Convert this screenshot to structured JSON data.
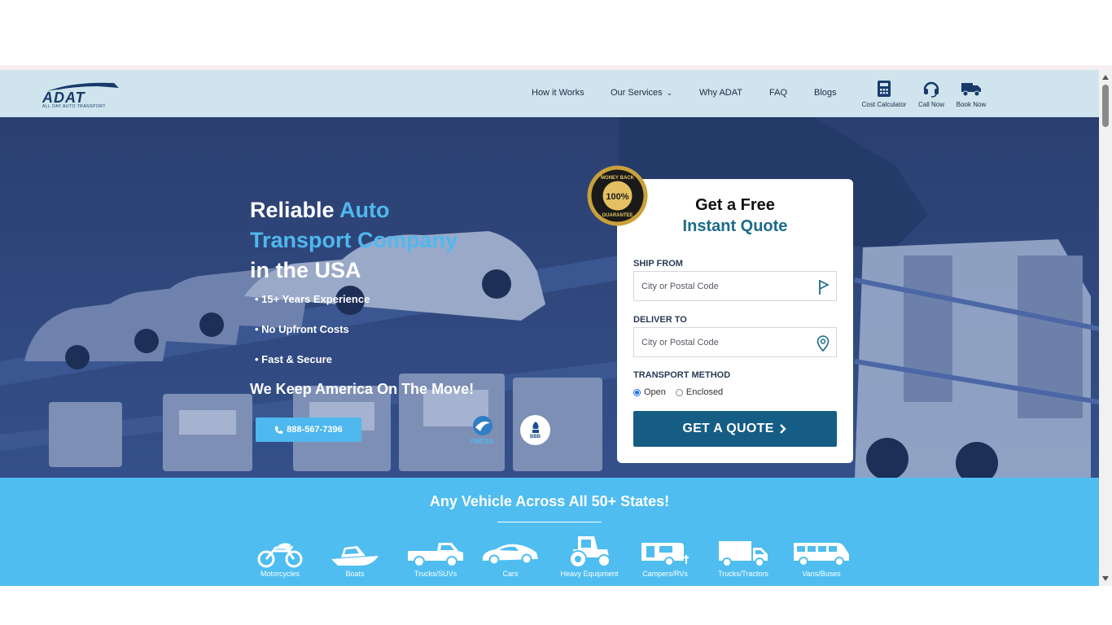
{
  "brand": {
    "logo_text": "ADAT",
    "logo_subtext": "ALL DAY AUTO TRANSPORT"
  },
  "nav": {
    "items": [
      {
        "label": "How it Works"
      },
      {
        "label": "Our Services"
      },
      {
        "label": "Why ADAT"
      },
      {
        "label": "FAQ"
      },
      {
        "label": "Blogs"
      }
    ],
    "actions": [
      {
        "label": "Cost Calculator",
        "icon": "calculator-icon"
      },
      {
        "label": "Call Now",
        "icon": "headset-icon"
      },
      {
        "label": "Book Now",
        "icon": "truck-icon"
      }
    ]
  },
  "hero": {
    "title_part1": "Reliable ",
    "title_accent": "Auto Transport Company",
    "title_part2": "in the USA",
    "bullets": [
      "• 15+ Years Experience",
      "• No Upfront Costs",
      "• Fast & Secure"
    ],
    "tagline": "We Keep America On The Move!",
    "phone": "888-567-7396",
    "fmcsa_label": "FMCSA",
    "bbb_label": "BBB",
    "badge": {
      "top_text": "MONEY BACK",
      "center_text": "100%",
      "bottom_text": "GUARANTEE"
    }
  },
  "quote": {
    "title_line1": "Get a Free",
    "title_line2": "Instant Quote",
    "ship_from_label": "SHIP FROM",
    "ship_from_placeholder": "City or Postal Code",
    "deliver_to_label": "DELIVER TO",
    "deliver_to_placeholder": "City or Postal Code",
    "transport_label": "TRANSPORT METHOD",
    "options": [
      {
        "label": "Open",
        "selected": true
      },
      {
        "label": "Enclosed",
        "selected": false
      }
    ],
    "button_label": "GET A QUOTE"
  },
  "vehicles": {
    "title": "Any Vehicle Across All 50+ States!",
    "items": [
      {
        "label": "Motorcycles",
        "icon": "motorcycle-icon"
      },
      {
        "label": "Boats",
        "icon": "boat-icon"
      },
      {
        "label": "Trucks/SUVs",
        "icon": "pickup-truck-icon"
      },
      {
        "label": "Cars",
        "icon": "car-icon"
      },
      {
        "label": "Heavy Equipment",
        "icon": "tractor-icon"
      },
      {
        "label": "Campers/RVs",
        "icon": "camper-icon"
      },
      {
        "label": "Trucks/Tractors",
        "icon": "box-truck-icon"
      },
      {
        "label": "Vans/Buses",
        "icon": "van-icon"
      }
    ]
  },
  "colors": {
    "header_bg": "#cfe4ec",
    "hero_overlay": "#2a3f70",
    "accent": "#4fb8ee",
    "quote_button": "#155d84",
    "vehicles_bg": "#4fbdf0"
  }
}
